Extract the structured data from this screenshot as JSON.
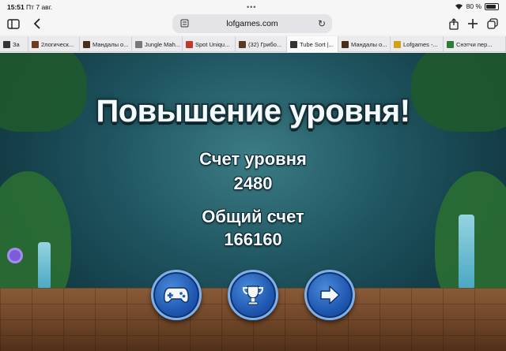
{
  "status_bar": {
    "time": "15:51",
    "date": "Пт 7 авг.",
    "battery": "80 %"
  },
  "toolbar": {
    "url": "lofgames.com"
  },
  "tabs": [
    {
      "label": "За",
      "favicon_color": "#333333"
    },
    {
      "label": "2логическ...",
      "favicon_color": "#6b3b1f"
    },
    {
      "label": "Мандалы о...",
      "favicon_color": "#4a2c1a"
    },
    {
      "label": "Jungle Mah...",
      "favicon_color": "#777777"
    },
    {
      "label": "Spot Uniqu...",
      "favicon_color": "#c0392b"
    },
    {
      "label": "(32) Грибо...",
      "favicon_color": "#5a3b22"
    },
    {
      "label": "Tube Sort |...",
      "favicon_color": "#333333",
      "active": true
    },
    {
      "label": "Мандалы о...",
      "favicon_color": "#4a2c1a"
    },
    {
      "label": "Lofgames -...",
      "favicon_color": "#d4a017"
    },
    {
      "label": "Снэтчи пер...",
      "favicon_color": "#2e7d32"
    }
  ],
  "game": {
    "title": "Повышение уровня!",
    "level_score_label": "Счет уровня",
    "level_score_value": "2480",
    "total_score_label": "Общий счет",
    "total_score_value": "166160",
    "buttons": [
      {
        "icon": "gamepad-icon"
      },
      {
        "icon": "trophy-icon"
      },
      {
        "icon": "arrow-right-icon"
      }
    ]
  }
}
